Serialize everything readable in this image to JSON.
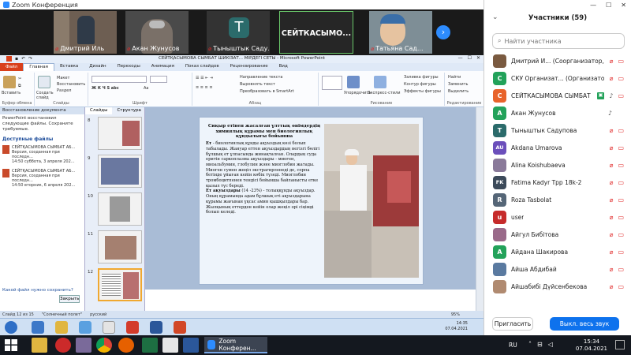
{
  "zoom": {
    "title": "Zoom Конференция",
    "window_controls": [
      "—",
      "☐",
      "✕"
    ],
    "video_tiles": [
      {
        "name": "Дмитрий Иль",
        "muted": true
      },
      {
        "name": "Акан Жунусов",
        "muted": true
      },
      {
        "name": "Тыныштык Саду...",
        "muted": true,
        "letter": "T"
      },
      {
        "name": "",
        "muted": false,
        "label": "СЕЙТКАСЫМО..."
      },
      {
        "name": "Татьяна Сад...",
        "muted": true
      }
    ],
    "next_arrow": "›"
  },
  "ppt": {
    "window_title": "СЕЙТҚАСЫМОВА СЫМБАТ ШИКІЗАТ... МІРДЕГІ СЕТЫ - Microsoft PowerPoint",
    "tabs": [
      "Файл",
      "Главная",
      "Вставка",
      "Дизайн",
      "Переходы",
      "Анимация",
      "Показ слайдов",
      "Рецензирование",
      "Вид"
    ],
    "ribbon": {
      "groups": [
        {
          "label": "Буфер обмена",
          "items": [
            "Вставить",
            "Вырезать",
            "Копировать"
          ]
        },
        {
          "label": "Слайды",
          "items": [
            "Создать слайд",
            "Макет",
            "Восстановить",
            "Раздел"
          ]
        },
        {
          "label": "Шрифт",
          "items": [
            "Ж К Ч S abc",
            "Aa"
          ]
        },
        {
          "label": "Абзац",
          "items": [
            "Направление текста",
            "Выровнять текст",
            "Преобразовать в SmartArt"
          ]
        },
        {
          "label": "Рисование",
          "items": [
            "Упорядочить",
            "Экспресс-стили",
            "Заливка фигуры",
            "Контур фигуры",
            "Эффекты фигуры"
          ]
        },
        {
          "label": "Редактирование",
          "items": [
            "Найти",
            "Заменить",
            "Выделить"
          ]
        }
      ]
    },
    "recovery": {
      "header": "Восстановление документа",
      "message": "PowerPoint восстановил следующие файлы. Сохраните требуемые.",
      "available_label": "Доступные файлы",
      "files": [
        {
          "name": "СЕЙТҚАСЫМОВА СЫМБАТ АБ...",
          "desc": "Версия, созданная при последн...",
          "time": "14:50 суббота, 3 апреля 202..."
        },
        {
          "name": "СЕЙТҚАСЫМОВА СЫМБАТ АБ...",
          "desc": "Версия, созданная при последн...",
          "time": "14:50 вторник, 6 апреля 202..."
        }
      ],
      "which_file": "Какой файл нужно сохранить?",
      "close_label": "Закрыть"
    },
    "slides_panel": {
      "tabs": [
        "Слайды",
        "Структура"
      ],
      "numbers": [
        "8",
        "9",
        "10",
        "11",
        "12"
      ],
      "selected": "12"
    },
    "slide": {
      "title": "Сиқыр етінен жасалған ұлттық өнімдердің химиялық құрамы мен биологиялық құндылығы бойынша",
      "body": [
        {
          "bold": "Ет",
          "text": " - биологиялық құнды ақуыздың көзі болып табылады. Жануар еттен ақуыздардың негізгі бөлігі бұлшық ет ұлпасында жинақталған. Олардың суда еритін саркоплазма ақуыздары - миоген, миоальбумин, глобулин және миоглобин жатады. Миоген сумен жеңіл экстрагирленеді де, сорпа бетінде ұйыған кейін көбік түзеді. Миоглобин тромбоцитпенен тендісі бойынша байланысты етке қызыл түс береді."
        },
        {
          "bold": "Ет ақуыздары",
          "text": " (14 -23%) - толыққұнды ақуыздар. Оның құрамында адам бұлшық еті ақуыздарына құрамы жағынан ұқсас амин қышқылдары бар. Жылқының еттерден кейін олар жеңіл әрі сіңімді болып келеді."
        }
      ]
    },
    "status": {
      "slide": "Слайд 12 из 15",
      "theme": "\"Солнечный полет\"",
      "lang": "русский",
      "zoom": "95%"
    },
    "inner_tray": {
      "time": "14:35",
      "date": "07.04.2021"
    }
  },
  "participants": {
    "title": "Участники (59)",
    "search_placeholder": "Найти участника",
    "list": [
      {
        "name": "Дмитрий И... (Соорганизатор, я)",
        "initial": "",
        "color": "#7a5a40",
        "mic": "muted",
        "video": "off"
      },
      {
        "name": "СКУ Организат... (Организатор)",
        "initial": "C",
        "color": "#23a25a",
        "mic": "muted",
        "video": "off"
      },
      {
        "name": "СЕЙТКАСЫМОВА СЫМБАТ",
        "initial": "C",
        "color": "#e8632b",
        "mic": "on",
        "video": "off",
        "sharing": true
      },
      {
        "name": "Акан Жунусов",
        "initial": "A",
        "color": "#23a25a",
        "mic": "on",
        "video": "none"
      },
      {
        "name": "Тыныштык Садупова",
        "initial": "T",
        "color": "#2b6b6b",
        "mic": "muted",
        "video": "off"
      },
      {
        "name": "Akdana Umarova",
        "initial": "AU",
        "color": "#6b4fbb",
        "mic": "muted",
        "video": "off"
      },
      {
        "name": "Alina Koishubaeva",
        "initial": "",
        "color": "#8a7a9a",
        "mic": "muted",
        "video": "off"
      },
      {
        "name": "Fatima Kadyr Tpp 18k-2",
        "initial": "FK",
        "color": "#3c4a5a",
        "mic": "muted",
        "video": "off"
      },
      {
        "name": "Roza Tasbolat",
        "initial": "R",
        "color": "#556677",
        "mic": "muted",
        "video": "off"
      },
      {
        "name": "user",
        "initial": "u",
        "color": "#c62b2b",
        "mic": "muted",
        "video": "off"
      },
      {
        "name": "Айгул Бибітова",
        "initial": "",
        "color": "#9a6a8a",
        "mic": "muted",
        "video": "off"
      },
      {
        "name": "Айдана Шакирова",
        "initial": "A",
        "color": "#23a25a",
        "mic": "muted",
        "video": "off"
      },
      {
        "name": "Айша Абдибай",
        "initial": "",
        "color": "#5a7aa0",
        "mic": "muted",
        "video": "off"
      },
      {
        "name": "Айшабибі Дүйсенбекова",
        "initial": "",
        "color": "#b08a70",
        "mic": "muted",
        "video": "off"
      }
    ],
    "invite_label": "Пригласить",
    "mute_all_label": "Выкл. весь звук"
  },
  "taskbar": {
    "zoom_app_label": "Zoom Конферен...",
    "lang": "RU",
    "time": "15:34",
    "date": "07.04.2021"
  },
  "colors": {
    "zoom_blue": "#0e72ed",
    "mute_red": "#e02828",
    "ppt_file_tab": "#d9401b"
  }
}
